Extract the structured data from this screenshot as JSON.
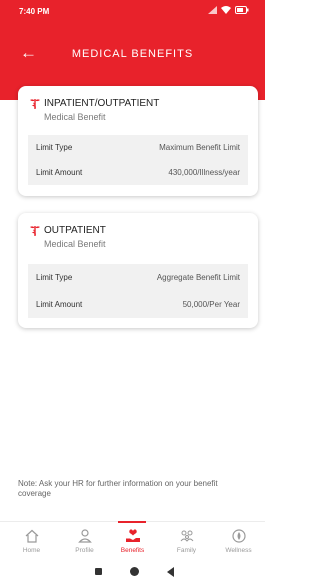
{
  "status_bar": {
    "time": "7:40 PM"
  },
  "header": {
    "title": "MEDICAL BENEFITS"
  },
  "cards": [
    {
      "title": "INPATIENT/OUTPATIENT",
      "subtitle": "Medical Benefit",
      "rows": [
        {
          "label": "Limit Type",
          "value": "Maximum Benefit Limit"
        },
        {
          "label": "Limit Amount",
          "value": "430,000/Illness/year"
        }
      ]
    },
    {
      "title": "OUTPATIENT",
      "subtitle": "Medical Benefit",
      "rows": [
        {
          "label": "Limit Type",
          "value": "Aggregate Benefit Limit"
        },
        {
          "label": "Limit Amount",
          "value": "50,000/Per Year"
        }
      ]
    }
  ],
  "note": "Note: Ask  your HR for further information on your benefit coverage",
  "bottom_nav": [
    {
      "label": "Home",
      "icon": "home-icon",
      "active": false
    },
    {
      "label": "Profile",
      "icon": "profile-icon",
      "active": false
    },
    {
      "label": "Benefits",
      "icon": "benefits-icon",
      "active": true
    },
    {
      "label": "Family",
      "icon": "family-icon",
      "active": false
    },
    {
      "label": "Wellness",
      "icon": "wellness-icon",
      "active": false
    }
  ],
  "colors": {
    "accent": "#e8222b",
    "header_text": "#ffffff",
    "table_bg": "#f1f1f1"
  }
}
